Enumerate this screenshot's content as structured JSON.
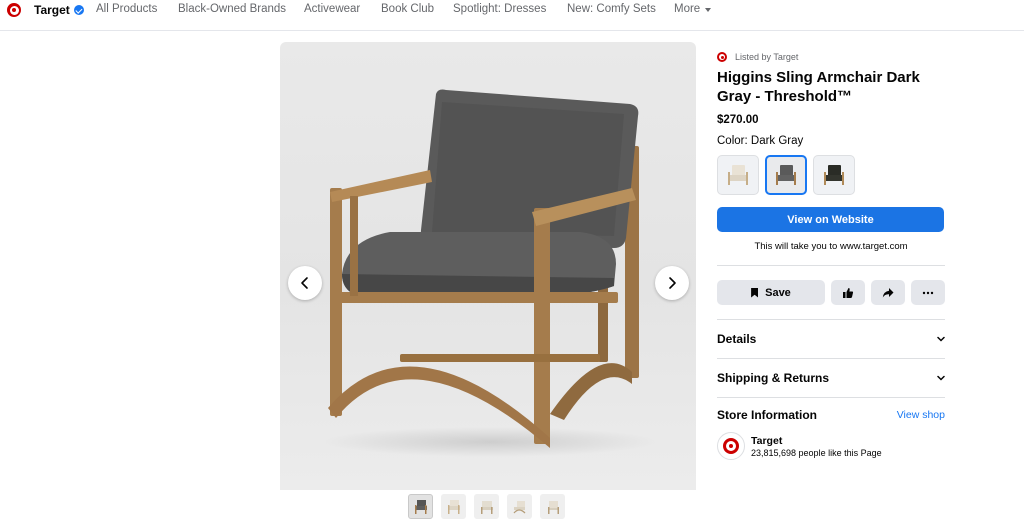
{
  "nav": {
    "brand": "Target",
    "items": [
      "All Products",
      "Black-Owned Brands",
      "Activewear",
      "Book Club",
      "Spotlight: Dresses",
      "New: Comfy Sets"
    ],
    "more": "More"
  },
  "listing": {
    "listed_by": "Listed by Target",
    "title": "Higgins Sling Armchair Dark Gray - Threshold™",
    "price": "$270.00",
    "color_label": "Color:",
    "color_value": "Dark Gray",
    "swatches": [
      "Cream",
      "Dark Gray",
      "Black"
    ],
    "selected_swatch": "Dark Gray",
    "cta": "View on Website",
    "redirect_note": "This will take you to www.target.com",
    "save_label": "Save"
  },
  "sections": {
    "details": "Details",
    "shipping": "Shipping & Returns"
  },
  "store": {
    "heading": "Store Information",
    "view_shop": "View shop",
    "name": "Target",
    "likes": "23,815,698 people like this Page"
  },
  "gallery": {
    "thumbnail_count": 5,
    "active_index": 0
  },
  "colors": {
    "brand_red": "#cc0000",
    "accent_blue": "#1877f2",
    "button_blue": "#1b74e4",
    "chair_fabric": "#545454",
    "chair_wood": "#a57c4c"
  }
}
